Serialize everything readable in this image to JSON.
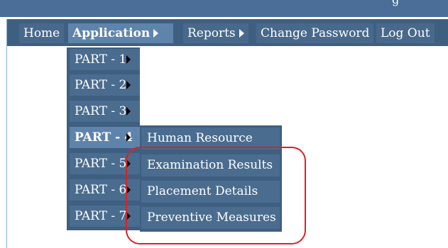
{
  "header": {
    "title_fragment": "g"
  },
  "nav": {
    "items": [
      {
        "label": "Home"
      },
      {
        "label": "Application"
      },
      {
        "label": "Reports"
      },
      {
        "label": "Change Password"
      },
      {
        "label": "Log Out"
      }
    ],
    "active": "Application"
  },
  "application_menu": {
    "items": [
      {
        "label": "PART - 1"
      },
      {
        "label": "PART - 2"
      },
      {
        "label": "PART - 3"
      },
      {
        "label": "PART - 4"
      },
      {
        "label": "PART - 5"
      },
      {
        "label": "PART - 6"
      },
      {
        "label": "PART - 7"
      }
    ],
    "active": "PART - 4"
  },
  "part4_submenu": {
    "items": [
      {
        "label": "Human Resource"
      },
      {
        "label": "Examination Results"
      },
      {
        "label": "Placement Details"
      },
      {
        "label": "Preventive Measures"
      }
    ]
  },
  "annotation": {
    "color": "#e02020"
  },
  "colors": {
    "header": "#4a6e97",
    "nav_bar": "#3f5f80",
    "menu_item": "#4a6c8f",
    "active_item": "#5f84ab",
    "text": "#ffffff"
  }
}
